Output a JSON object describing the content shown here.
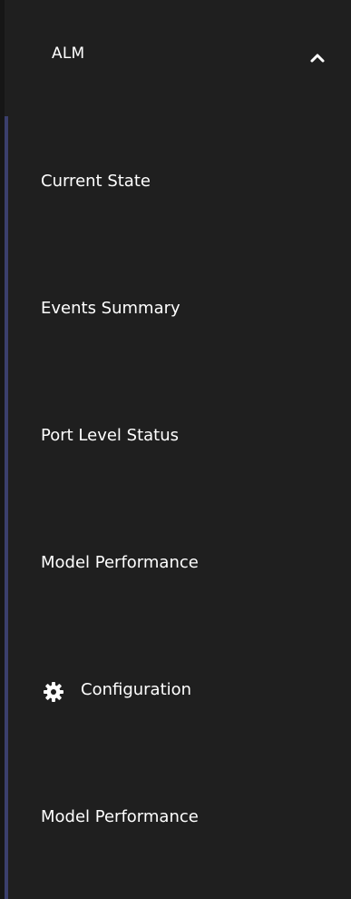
{
  "colors": {
    "background": "#1f1f1f",
    "rail": "#161616",
    "accent": "#3b3f6d",
    "text": "#ffffff"
  },
  "section": {
    "title": "ALM",
    "expanded": true,
    "chevron_icon": "chevron-up-icon"
  },
  "menu": {
    "items": [
      {
        "label": "Current State"
      },
      {
        "label": "Events Summary"
      },
      {
        "label": "Port Level Status"
      },
      {
        "label": "Model Performance"
      },
      {
        "label": "Configuration",
        "icon": "gear-icon"
      },
      {
        "label": "Model Performance"
      }
    ]
  }
}
